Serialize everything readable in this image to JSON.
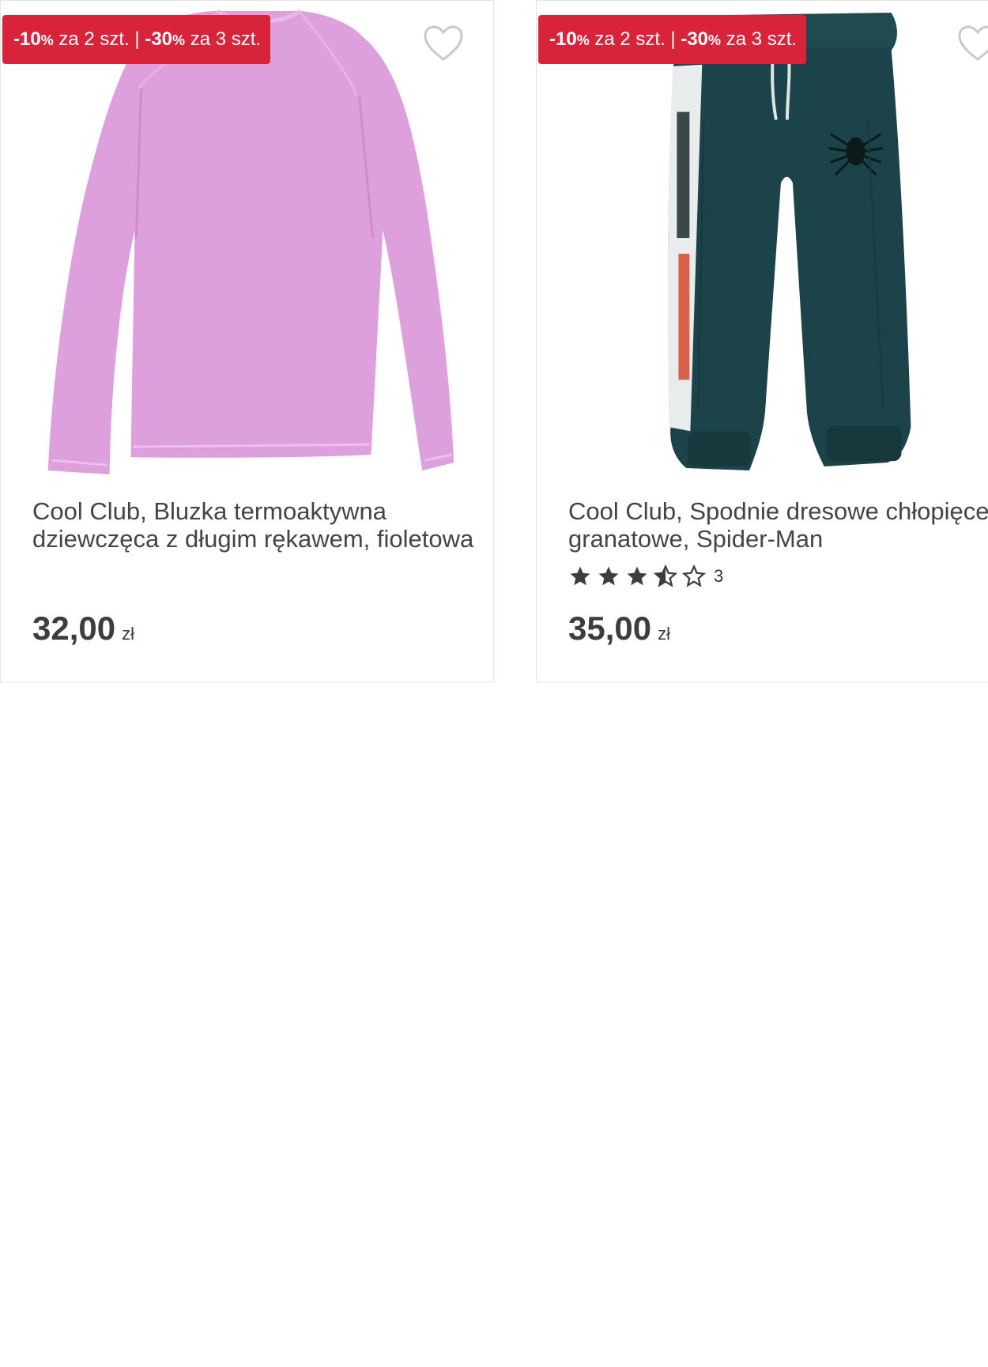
{
  "colors": {
    "promo_badge": "#d8243b",
    "text": "#444444",
    "border": "#e4e4e4"
  },
  "products": [
    {
      "promo": {
        "part1_value": "-10",
        "part1_unit": "%",
        "part1_text": " za 2 szt.",
        "separator": " | ",
        "part2_value": "-30",
        "part2_unit": "%",
        "part2_text": " za 3 szt."
      },
      "favorite_icon": "heart-outline-icon",
      "image": "pink-long-sleeve-shirt",
      "title": "Cool Club, Bluzka termoaktywna dziewczęca z długim rękawem, fioletowa",
      "price": "32,00",
      "currency": "zł"
    },
    {
      "promo": {
        "part1_value": "-10",
        "part1_unit": "%",
        "part1_text": " za 2 szt.",
        "separator": " | ",
        "part2_value": "-30",
        "part2_unit": "%",
        "part2_text": " za 3 szt."
      },
      "favorite_icon": "heart-outline-icon",
      "image": "navy-sweatpants-spider-man",
      "title": "Cool Club, Spodnie dresowe chłopięce, granatowe, Spider-Man",
      "rating": 3.5,
      "rating_max": 5,
      "rating_count": "3",
      "price": "35,00",
      "currency": "zł"
    }
  ]
}
